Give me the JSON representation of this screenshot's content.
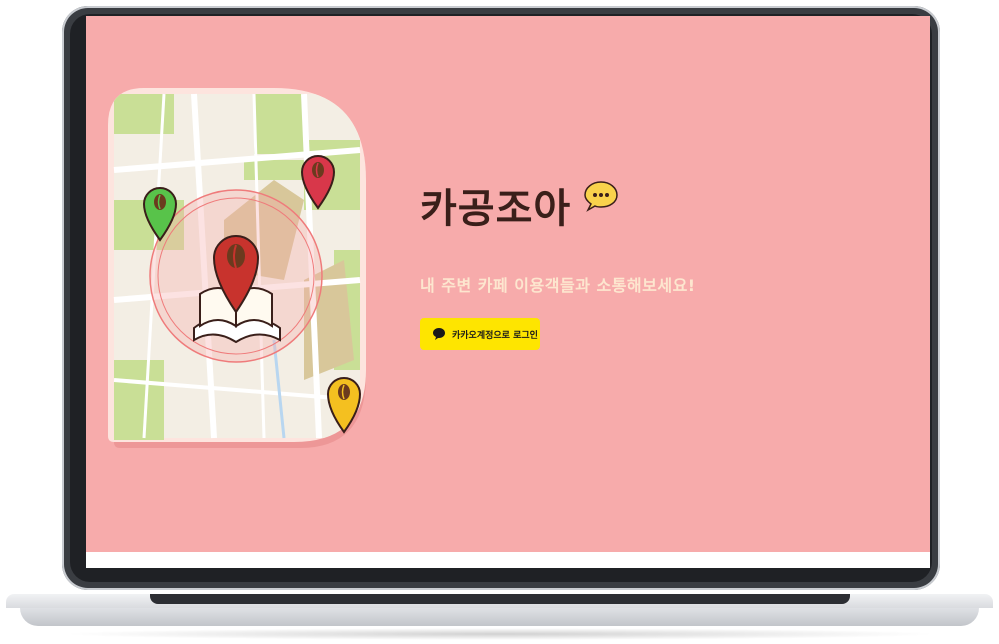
{
  "app": {
    "title": "카공조아",
    "subtitle": "내 주변 카페 이용객들과 소통해보세요!"
  },
  "login": {
    "kakao_label": "카카오계정으로 로그인"
  },
  "icons": {
    "title_badge": "chat-bubble-icon",
    "login_icon": "kakao-speech-icon",
    "map_markers": [
      "green-bean-pin-icon",
      "red-bean-pin-icon",
      "brown-bean-pin-icon",
      "yellow-bean-pin-icon"
    ],
    "center_icon": "open-book-icon"
  },
  "colors": {
    "background": "#f7abab",
    "title": "#3a1f1a",
    "subtitle": "#fde6cf",
    "kakao_button": "#fee500",
    "badge": "#f9d24c"
  }
}
